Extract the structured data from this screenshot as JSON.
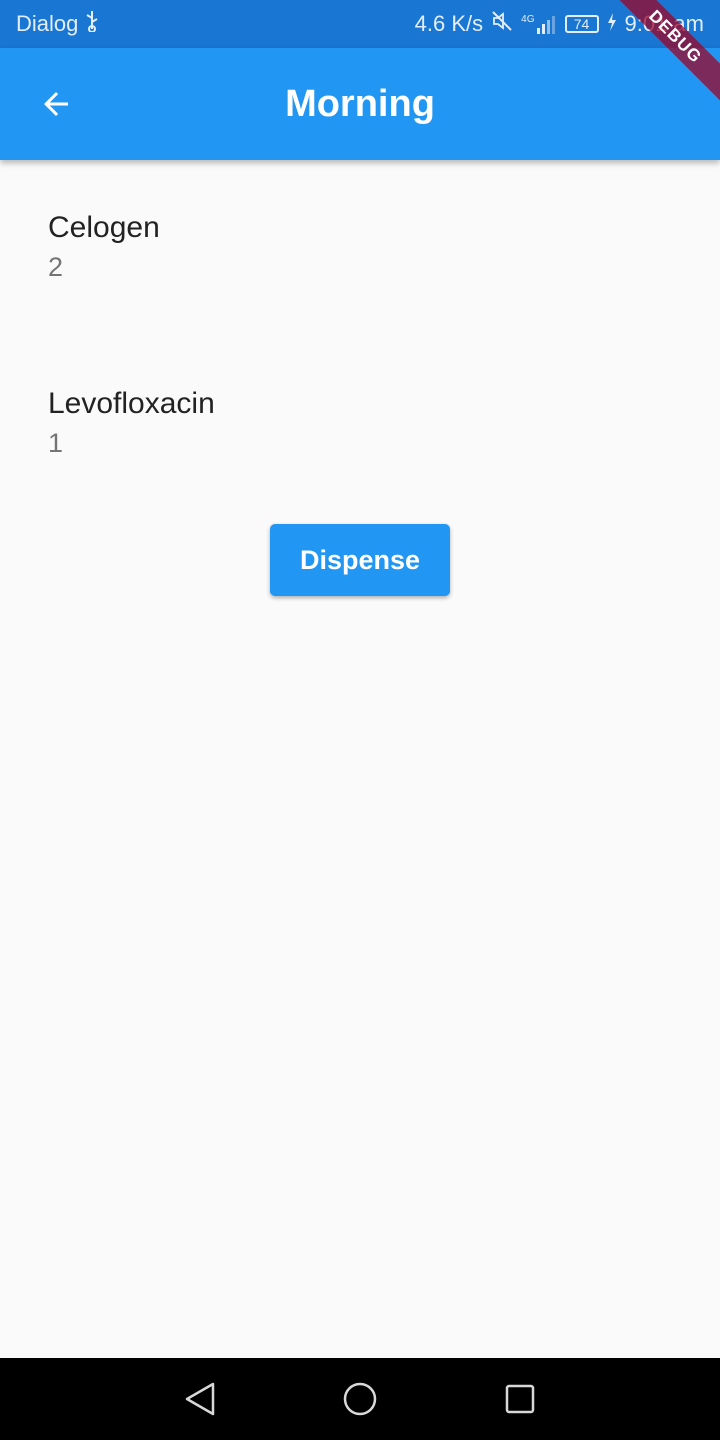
{
  "status_bar": {
    "carrier": "Dialog",
    "usb_icon": "usb-icon",
    "network_speed": "4.6 K/s",
    "mute_icon": "mute-icon",
    "signal_label": "4G",
    "battery_level": "74",
    "time": "9:01 am"
  },
  "app_bar": {
    "title": "Morning",
    "back_icon": "arrow-back-icon",
    "background_color": "#2196f3"
  },
  "debug_banner": "DEBUG",
  "medications": [
    {
      "name": "Celogen",
      "quantity": "2"
    },
    {
      "name": "Levofloxacin",
      "quantity": "1"
    }
  ],
  "actions": {
    "dispense_label": "Dispense"
  },
  "nav_bar": {
    "back_icon": "nav-back-icon",
    "home_icon": "nav-home-icon",
    "recents_icon": "nav-recents-icon"
  }
}
